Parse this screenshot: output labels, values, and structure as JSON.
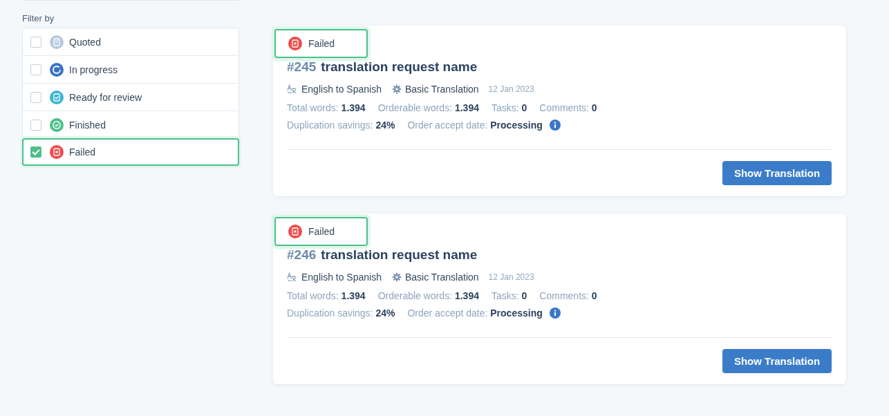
{
  "filters": {
    "title": "Filter by",
    "items": [
      {
        "label": "Quoted",
        "kind": "quoted",
        "checked": false,
        "selected": false
      },
      {
        "label": "In progress",
        "kind": "in_progress",
        "checked": false,
        "selected": false
      },
      {
        "label": "Ready for review",
        "kind": "ready",
        "checked": false,
        "selected": false
      },
      {
        "label": "Finished",
        "kind": "finished",
        "checked": false,
        "selected": false
      },
      {
        "label": "Failed",
        "kind": "failed",
        "checked": true,
        "selected": true
      }
    ]
  },
  "cards": [
    {
      "status": {
        "kind": "failed",
        "label": "Failed",
        "highlighted": true
      },
      "number": "#245",
      "name": "translation request name",
      "language_pair": "English to Spanish",
      "service": "Basic Translation",
      "date": "12 Jan 2023",
      "stats": [
        {
          "label": "Total words:",
          "value": "1.394"
        },
        {
          "label": "Orderable words:",
          "value": "1.394"
        },
        {
          "label": "Tasks:",
          "value": "0"
        },
        {
          "label": "Comments:",
          "value": "0"
        }
      ],
      "details": [
        {
          "label": "Duplication savings:",
          "value": "24%",
          "info": false
        },
        {
          "label": "Order accept date:",
          "value": "Processing",
          "info": true
        }
      ],
      "button": "Show Translation"
    },
    {
      "status": {
        "kind": "failed",
        "label": "Failed",
        "highlighted": true
      },
      "number": "#246",
      "name": "translation request name",
      "language_pair": "English to Spanish",
      "service": "Basic Translation",
      "date": "12 Jan 2023",
      "stats": [
        {
          "label": "Total words:",
          "value": "1.394"
        },
        {
          "label": "Orderable words:",
          "value": "1.394"
        },
        {
          "label": "Tasks:",
          "value": "0"
        },
        {
          "label": "Comments:",
          "value": "0"
        }
      ],
      "details": [
        {
          "label": "Duplication savings:",
          "value": "24%",
          "info": false
        },
        {
          "label": "Order accept date:",
          "value": "Processing",
          "info": true
        }
      ],
      "button": "Show Translation"
    }
  ]
}
